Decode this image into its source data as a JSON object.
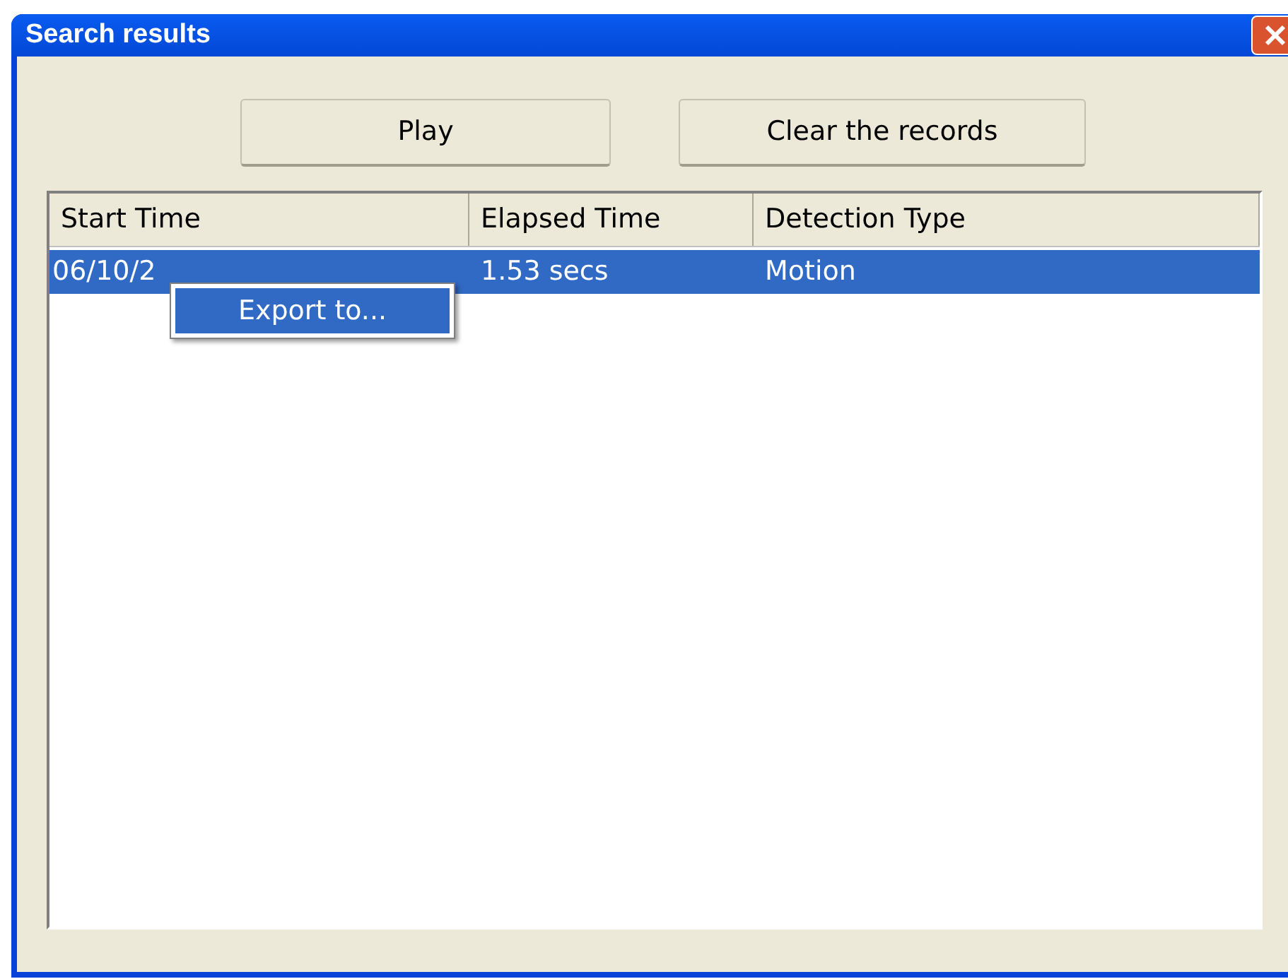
{
  "window": {
    "title": "Search results"
  },
  "buttons": [
    "Play",
    "Clear the records"
  ],
  "table": {
    "columns": [
      "Start Time",
      "Elapsed Time",
      "Detection Type"
    ],
    "rows": [
      {
        "cells": [
          "06/10/2",
          "1.53 secs",
          "Motion"
        ],
        "selected": true
      }
    ]
  },
  "context_menu": {
    "items": [
      {
        "label": "Export to...",
        "selected": true
      }
    ]
  }
}
